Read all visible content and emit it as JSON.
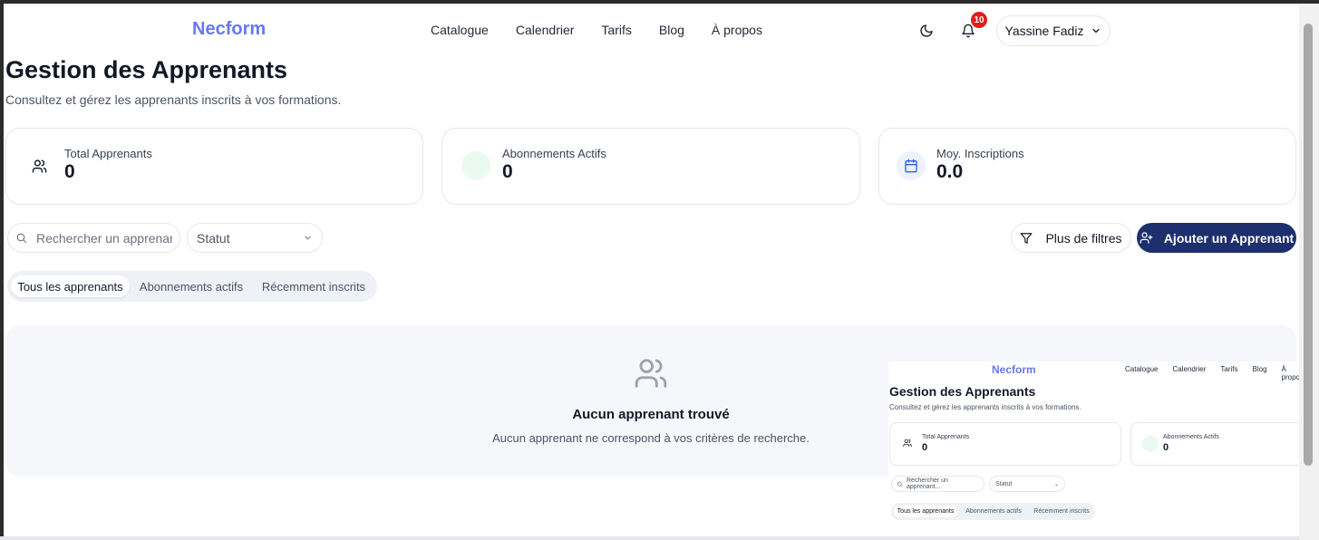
{
  "header": {
    "logo": "Necform",
    "nav": [
      "Catalogue",
      "Calendrier",
      "Tarifs",
      "Blog",
      "À propos"
    ],
    "notifications_count": "10",
    "user_name": "Yassine Fadiz"
  },
  "page": {
    "title": "Gestion des Apprenants",
    "subtitle": "Consultez et gérez les apprenants inscrits à vos formations."
  },
  "stats": [
    {
      "label": "Total Apprenants",
      "value": "0",
      "icon": "users-icon"
    },
    {
      "label": "Abonnements Actifs",
      "value": "0",
      "icon": "blank-circle"
    },
    {
      "label": "Moy. Inscriptions",
      "value": "0.0",
      "icon": "calendar-icon"
    }
  ],
  "filters": {
    "search_placeholder": "Rechercher un apprenant...",
    "status_label": "Statut",
    "more_filters": "Plus de filtres",
    "add_button": "Ajouter un Apprenant"
  },
  "tabs": [
    "Tous les apprenants",
    "Abonnements actifs",
    "Récemment inscrits"
  ],
  "empty_state": {
    "title": "Aucun apprenant trouvé",
    "description": "Aucun apprenant ne correspond à vos critères de recherche."
  },
  "colors": {
    "brand": "#6678f0",
    "primary_button": "#1e2f6e",
    "badge": "#e11d1d"
  }
}
